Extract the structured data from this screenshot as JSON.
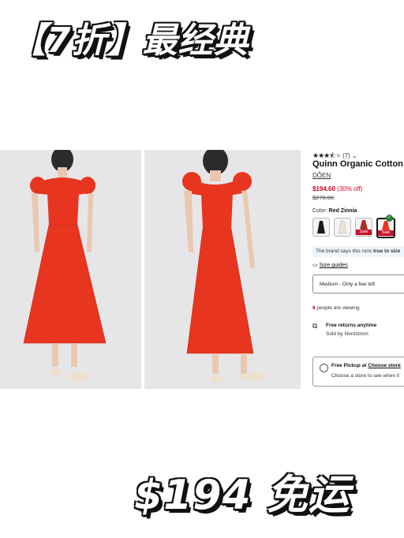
{
  "banner": {
    "top": "【7折】最经典",
    "bottom": "$194 免运"
  },
  "product": {
    "rating_count": "(7)",
    "rating_value": 3.5,
    "rating_max": 5,
    "rating_chevron": "⌄",
    "title": "Quinn Organic Cotton P",
    "brand": "DÔEN",
    "price": "$194.60",
    "discount": "(30% off)",
    "original_price": "$278.00",
    "color_label": "Color:",
    "color_value": "Red Zinnia",
    "swatches": [
      {
        "name": "black",
        "color": "#1a1a1a",
        "sale": ""
      },
      {
        "name": "cream",
        "color": "#e9e2d6",
        "sale": ""
      },
      {
        "name": "red-print",
        "color": "#b02a2a",
        "sale": "Sale"
      },
      {
        "name": "red-zinnia",
        "color": "#e8351f",
        "sale": "Sale",
        "selected": true
      }
    ],
    "fit_note_prefix": "The brand says this runs ",
    "fit_note_bold": "true to size",
    "size_guides": "Size guides",
    "size_select": "Medium - Only a few left",
    "viewing_count": "8",
    "viewing_text": " people are viewing",
    "returns_title": "Free returns anytime",
    "returns_sub": "Sold by Nordstrom",
    "pickup_title_prefix": "Free Pickup at ",
    "pickup_title_link": "Choose store",
    "pickup_sub": "Choose a store to see when it"
  },
  "colors": {
    "dress": "#e8351f",
    "sale": "#d6001c",
    "photo_bg": "#e6e6e8"
  }
}
